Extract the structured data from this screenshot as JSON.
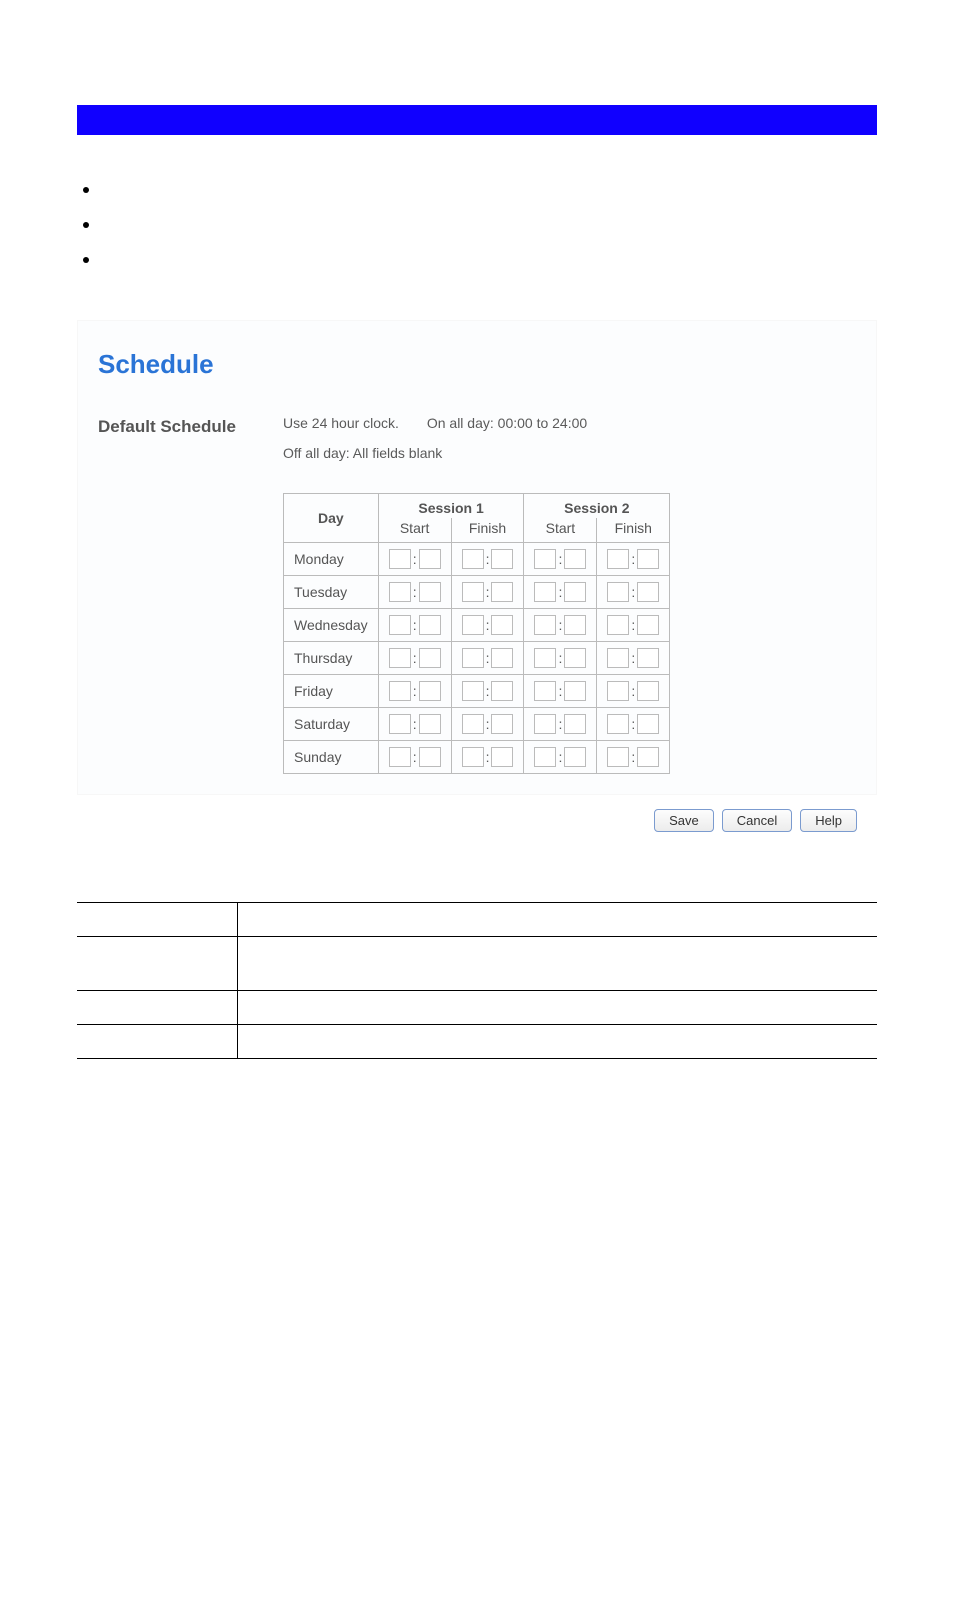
{
  "panel": {
    "title": "Schedule",
    "section_label": "Default Schedule",
    "hint_clock": "Use 24 hour clock.",
    "hint_on": "On all day:  00:00 to 24:00",
    "hint_off": "Off all day:  All fields blank"
  },
  "table": {
    "day_header": "Day",
    "session1_header": "Session 1",
    "session2_header": "Session 2",
    "start_label": "Start",
    "finish_label": "Finish",
    "days": [
      "Monday",
      "Tuesday",
      "Wednesday",
      "Thursday",
      "Friday",
      "Saturday",
      "Sunday"
    ],
    "values": {
      "Monday": {
        "s1sh": "",
        "s1sm": "",
        "s1fh": "",
        "s1fm": "",
        "s2sh": "",
        "s2sm": "",
        "s2fh": "",
        "s2fm": ""
      },
      "Tuesday": {
        "s1sh": "",
        "s1sm": "",
        "s1fh": "",
        "s1fm": "",
        "s2sh": "",
        "s2sm": "",
        "s2fh": "",
        "s2fm": ""
      },
      "Wednesday": {
        "s1sh": "",
        "s1sm": "",
        "s1fh": "",
        "s1fm": "",
        "s2sh": "",
        "s2sm": "",
        "s2fh": "",
        "s2fm": ""
      },
      "Thursday": {
        "s1sh": "",
        "s1sm": "",
        "s1fh": "",
        "s1fm": "",
        "s2sh": "",
        "s2sm": "",
        "s2fh": "",
        "s2fm": ""
      },
      "Friday": {
        "s1sh": "",
        "s1sm": "",
        "s1fh": "",
        "s1fm": "",
        "s2sh": "",
        "s2sm": "",
        "s2fh": "",
        "s2fm": ""
      },
      "Saturday": {
        "s1sh": "",
        "s1sm": "",
        "s1fh": "",
        "s1fm": "",
        "s2sh": "",
        "s2sm": "",
        "s2fh": "",
        "s2fm": ""
      },
      "Sunday": {
        "s1sh": "",
        "s1sm": "",
        "s1fh": "",
        "s1fm": "",
        "s2sh": "",
        "s2sm": "",
        "s2fh": "",
        "s2fm": ""
      }
    }
  },
  "buttons": {
    "save": "Save",
    "cancel": "Cancel",
    "help": "Help"
  }
}
